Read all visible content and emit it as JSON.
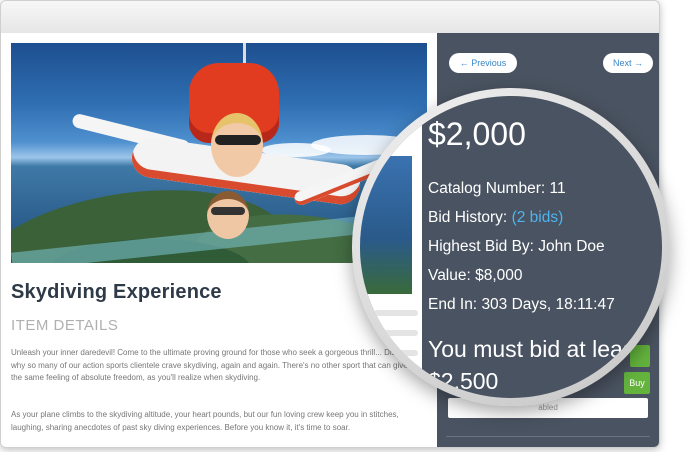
{
  "nav": {
    "previous": "← Previous",
    "next": "Next →"
  },
  "item": {
    "title": "Skydiving Experience",
    "section_label": "ITEM DETAILS",
    "paragraph1": "Unleash your inner daredevil! Come to the ultimate proving ground for those who seek a gorgeous thrill... Discover why so many of our action sports clientele crave skydiving, again and again. There's no other sport that can give you the same feeling of absolute freedom, as you'll realize when skydiving.",
    "paragraph2": "As your plane climbs to the skydiving altitude, your heart pounds, but our fun loving crew keep you in stitches, laughing, sharing anecdotes of past sky diving experiences. Before you know it, it's time to soar."
  },
  "bid": {
    "current_price": "$2,000",
    "catalog_label": "Catalog Number:",
    "catalog_value": "11",
    "history_label": "Bid History:",
    "history_link": "(2 bids)",
    "highest_label": "Highest Bid By:",
    "highest_value": "John Doe",
    "value_label": "Value:",
    "value_amount": "$8,000",
    "end_label": "End In:",
    "end_value": "303 Days, 18:11:47",
    "notice": "You must bid at leas",
    "min_bid": "$2,500",
    "buy_label": "Buy",
    "disabled_text": "abled"
  },
  "colors": {
    "sidebar": "#4a5361",
    "link": "#4db4ef",
    "buy": "#63b33d",
    "title": "#2f3a48"
  }
}
